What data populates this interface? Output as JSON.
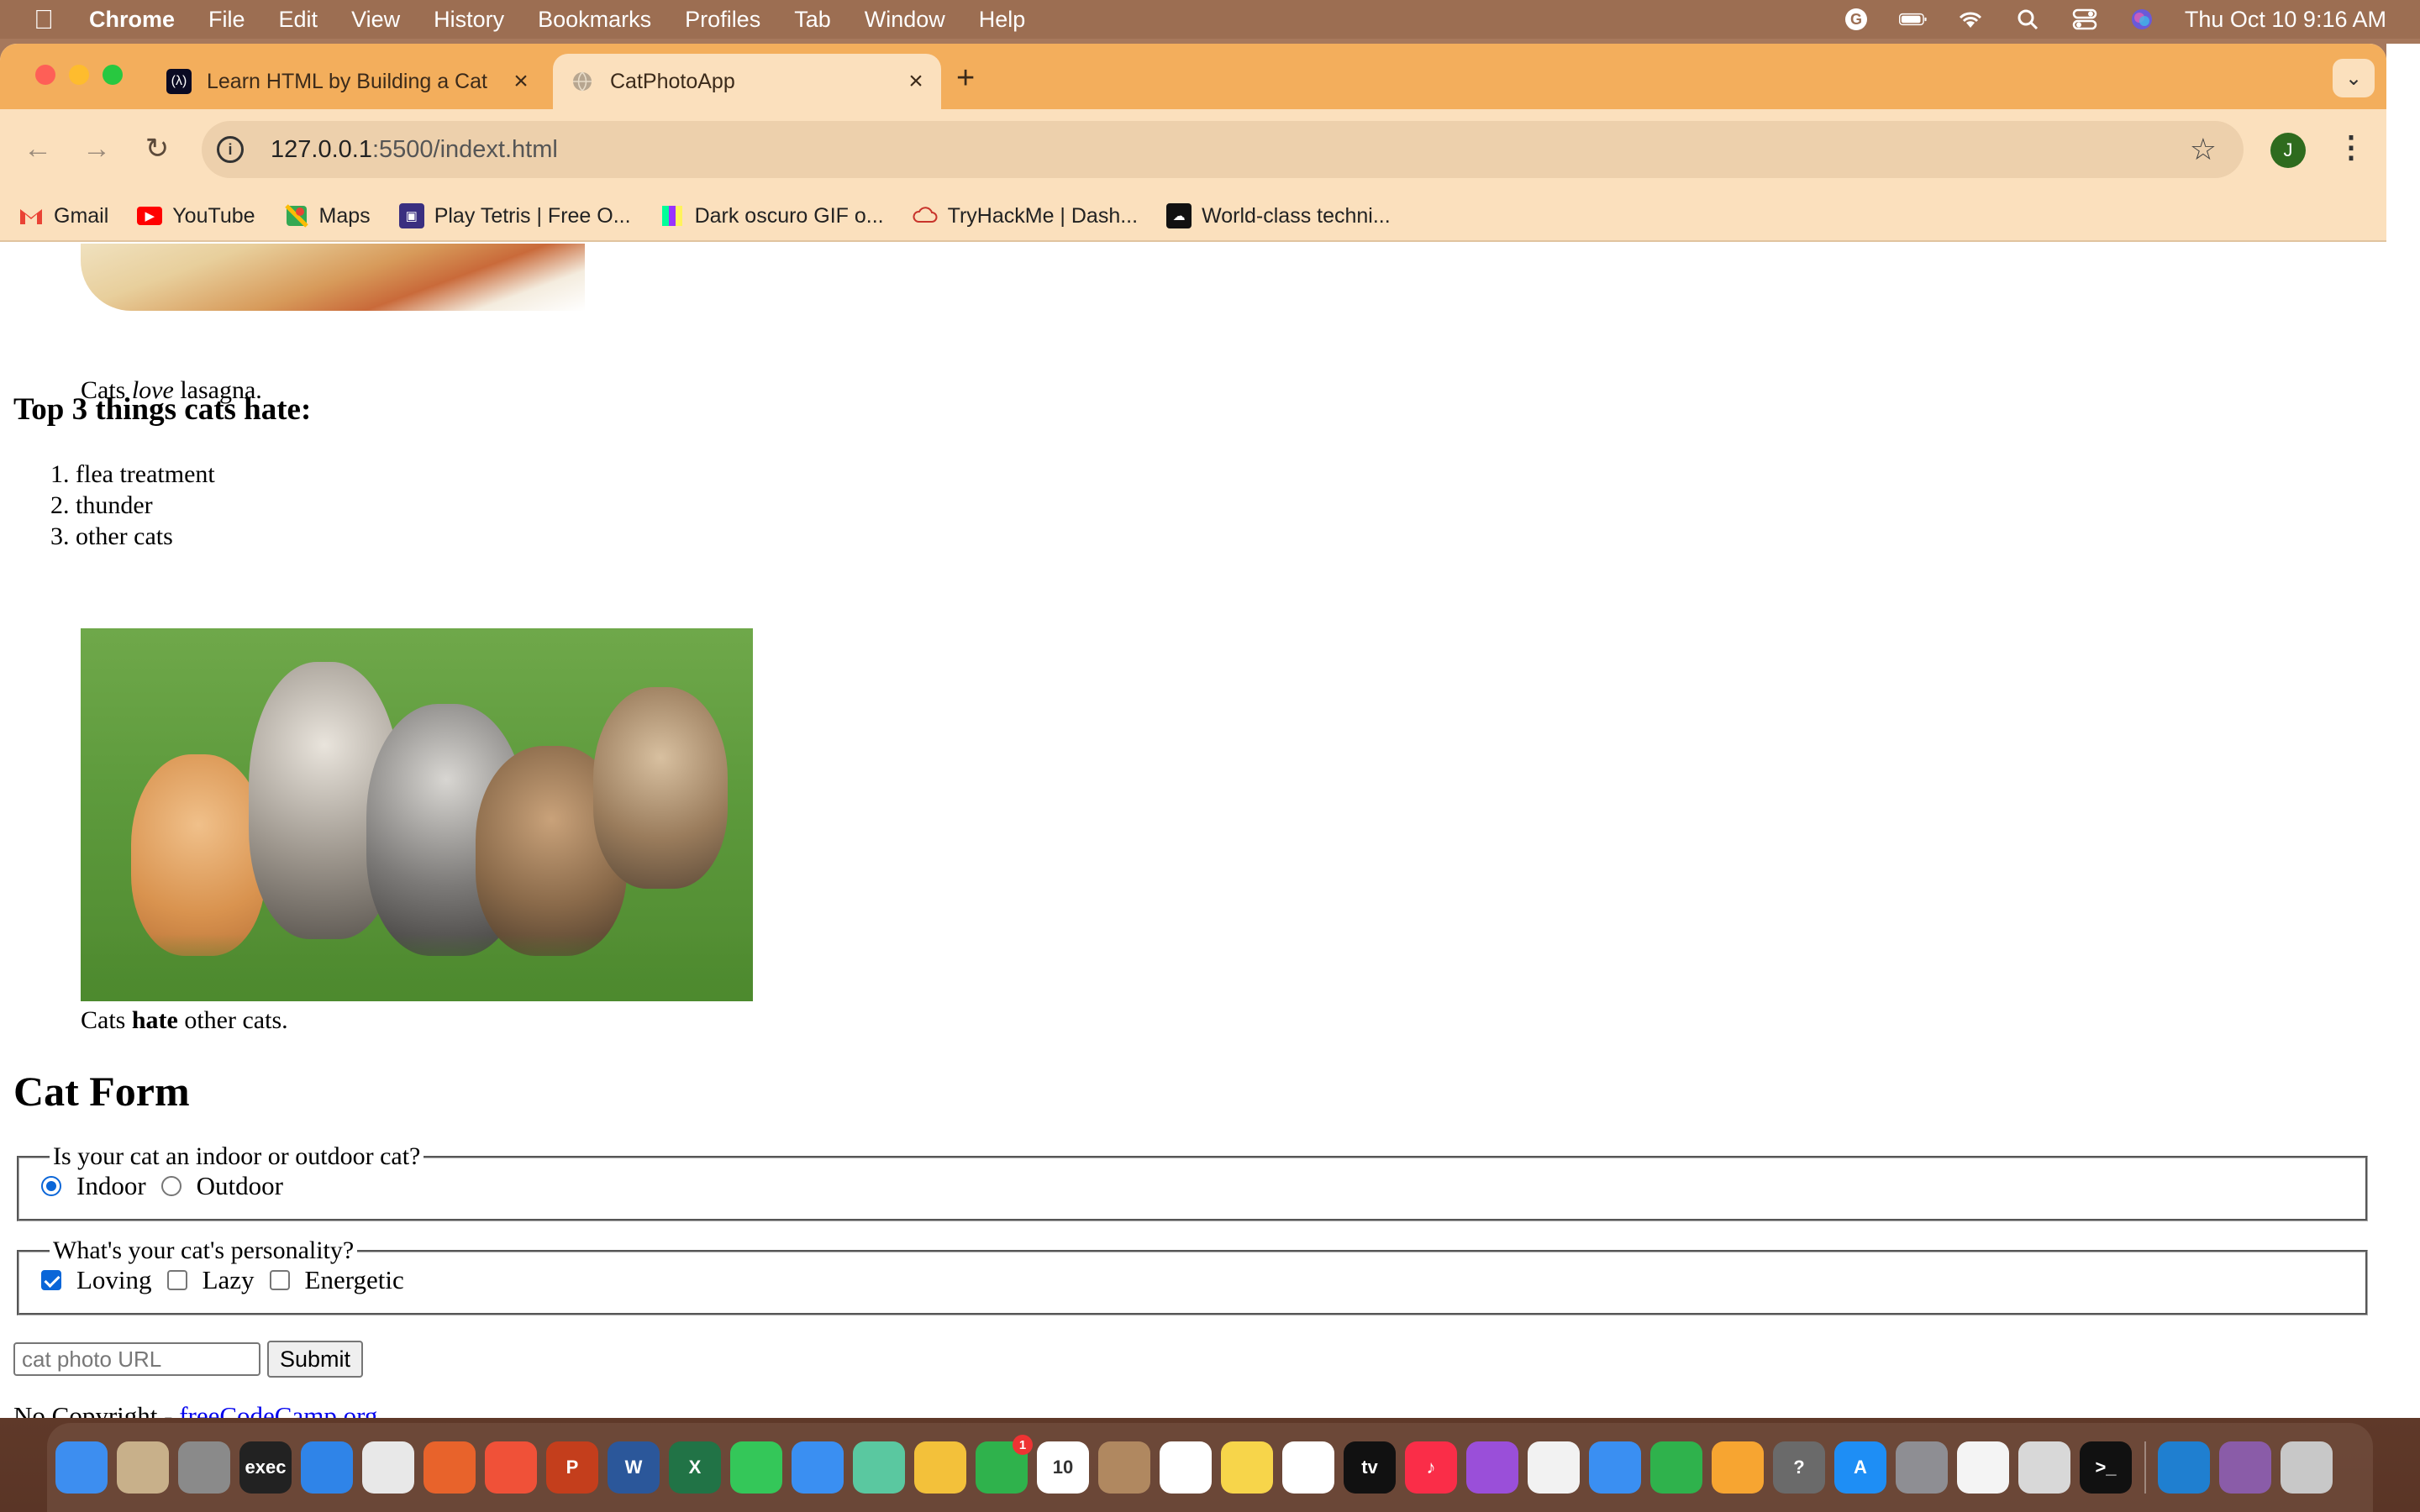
{
  "menubar": {
    "apple": "",
    "app_name": "Chrome",
    "items": [
      "File",
      "Edit",
      "View",
      "History",
      "Bookmarks",
      "Profiles",
      "Tab",
      "Window",
      "Help"
    ],
    "clock": "Thu Oct 10  9:16 AM"
  },
  "tabs": [
    {
      "title": "Learn HTML by Building a Cat",
      "favicon": "freecodecamp-icon",
      "active": false
    },
    {
      "title": "CatPhotoApp",
      "favicon": "globe-icon",
      "active": true
    }
  ],
  "address_bar": {
    "host": "127.0.0.1",
    "path": ":5500/indext.html"
  },
  "profile_initial": "J",
  "bookmarks": [
    {
      "label": "Gmail",
      "icon": "gmail-icon",
      "color": "#ea4335"
    },
    {
      "label": "YouTube",
      "icon": "youtube-icon",
      "color": "#ff0000"
    },
    {
      "label": "Maps",
      "icon": "maps-icon",
      "color": "#34a853"
    },
    {
      "label": "Play Tetris | Free O...",
      "icon": "tetris-icon",
      "color": "#3a2f80"
    },
    {
      "label": "Dark oscuro GIF o...",
      "icon": "giphy-icon",
      "color": "#7b3fe4"
    },
    {
      "label": "TryHackMe | Dash...",
      "icon": "tryhackme-icon",
      "color": "#c8342b"
    },
    {
      "label": "World-class techni...",
      "icon": "hackthebox-icon",
      "color": "#111111"
    }
  ],
  "page": {
    "caption1": {
      "pre": "Cats ",
      "em": "love",
      "post": " lasagna."
    },
    "hate_heading": "Top 3 things cats hate:",
    "hate_items": [
      "flea treatment",
      "thunder",
      "other cats"
    ],
    "kittens_alt": "",
    "caption2": {
      "pre": "Cats ",
      "strong": "hate",
      "post": " other cats."
    },
    "form_heading": "Cat Form",
    "fieldset1": {
      "legend": "Is your cat an indoor or outdoor cat?",
      "options": [
        {
          "label": "Indoor",
          "checked": true
        },
        {
          "label": "Outdoor",
          "checked": false
        }
      ]
    },
    "fieldset2": {
      "legend": "What's your cat's personality?",
      "options": [
        {
          "label": "Loving",
          "checked": true
        },
        {
          "label": "Lazy",
          "checked": false
        },
        {
          "label": "Energetic",
          "checked": false
        }
      ]
    },
    "url_placeholder": "cat photo URL",
    "submit_label": "Submit",
    "footer": {
      "text": "No Copyright - ",
      "link": "freeCodeCamp.org"
    }
  },
  "dock": [
    {
      "name": "finder-icon",
      "color": "#3d8ef0",
      "label": ""
    },
    {
      "name": "preview-icon",
      "color": "#c8b08a",
      "label": ""
    },
    {
      "name": "launchpad-icon",
      "color": "#8a8a8a",
      "label": ""
    },
    {
      "name": "terminal-exec-icon",
      "color": "#222222",
      "label": "exec"
    },
    {
      "name": "safari-icon",
      "color": "#2f84e8",
      "label": ""
    },
    {
      "name": "chrome-icon",
      "color": "#e8e8e8",
      "label": ""
    },
    {
      "name": "firefox-icon",
      "color": "#e8632b",
      "label": ""
    },
    {
      "name": "swift-playgrounds-icon",
      "color": "#f05138",
      "label": ""
    },
    {
      "name": "powerpoint-icon",
      "color": "#c43e1c",
      "label": "P"
    },
    {
      "name": "word-icon",
      "color": "#2b579a",
      "label": "W"
    },
    {
      "name": "excel-icon",
      "color": "#217346",
      "label": "X"
    },
    {
      "name": "messages-icon",
      "color": "#34c759",
      "label": ""
    },
    {
      "name": "mail-icon",
      "color": "#3a8ff2",
      "label": ""
    },
    {
      "name": "maps-app-icon",
      "color": "#5ac8a0",
      "label": ""
    },
    {
      "name": "photos-icon",
      "color": "#f3c13a",
      "label": ""
    },
    {
      "name": "facetime-icon",
      "color": "#2fb24c",
      "label": "",
      "badge": "1"
    },
    {
      "name": "calendar-icon",
      "color": "#ffffff",
      "label": "10"
    },
    {
      "name": "contacts-icon",
      "color": "#b08860",
      "label": ""
    },
    {
      "name": "reminders-icon",
      "color": "#ffffff",
      "label": ""
    },
    {
      "name": "notes-icon",
      "color": "#f7d54a",
      "label": ""
    },
    {
      "name": "freeform-icon",
      "color": "#ffffff",
      "label": ""
    },
    {
      "name": "apple-tv-icon",
      "color": "#111111",
      "label": "tv"
    },
    {
      "name": "music-icon",
      "color": "#fa2d48",
      "label": "♪"
    },
    {
      "name": "podcasts-icon",
      "color": "#9a4fd9",
      "label": ""
    },
    {
      "name": "news-icon",
      "color": "#f2f2f2",
      "label": ""
    },
    {
      "name": "keynote-icon",
      "color": "#3a8ff2",
      "label": ""
    },
    {
      "name": "numbers-icon",
      "color": "#2fb24c",
      "label": ""
    },
    {
      "name": "pages-icon",
      "color": "#f7a531",
      "label": ""
    },
    {
      "name": "help-icon",
      "color": "#6a6a6a",
      "label": "?"
    },
    {
      "name": "app-store-icon",
      "color": "#1e8ef5",
      "label": "A"
    },
    {
      "name": "system-settings-icon",
      "color": "#8e8e93",
      "label": ""
    },
    {
      "name": "textedit-icon",
      "color": "#f4f4f4",
      "label": ""
    },
    {
      "name": "screenshot-icon",
      "color": "#d8d8d8",
      "label": ""
    },
    {
      "name": "terminal-icon",
      "color": "#111111",
      "label": ">_"
    },
    {
      "name": "vscode-icon",
      "color": "#1f7fd0",
      "label": ""
    },
    {
      "name": "downloads-stack-icon",
      "color": "#8a5ca8",
      "label": ""
    },
    {
      "name": "trash-icon",
      "color": "#c8c8c8",
      "label": ""
    }
  ]
}
